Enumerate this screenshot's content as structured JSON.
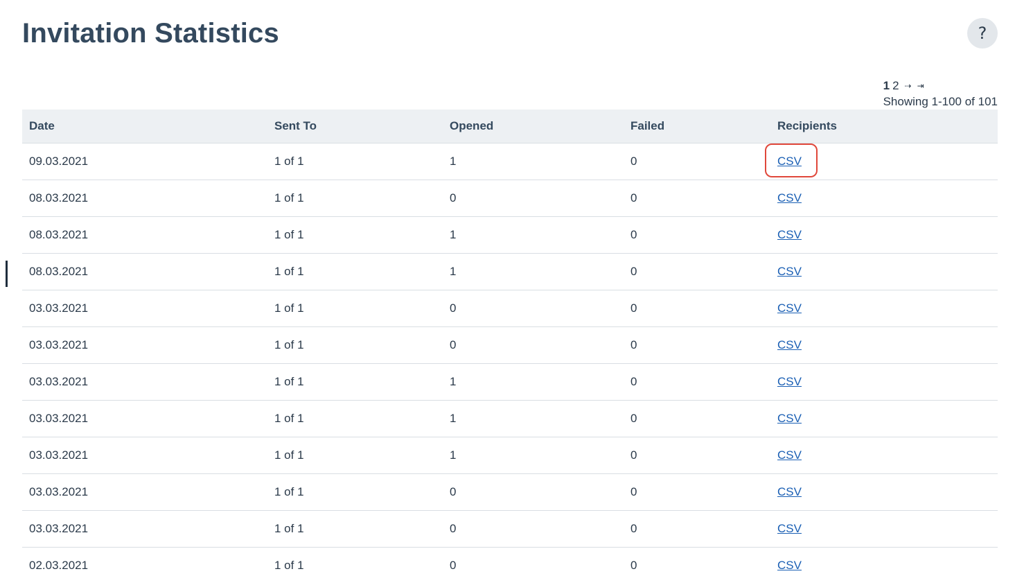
{
  "header": {
    "title": "Invitation Statistics",
    "help_label": "?"
  },
  "pagination": {
    "current_page": "1",
    "next_page": "2",
    "next_arrow": "⇢",
    "last_arrow": "⇥",
    "summary": "Showing 1-100 of 101"
  },
  "table": {
    "columns": [
      "Date",
      "Sent To",
      "Opened",
      "Failed",
      "Recipients"
    ],
    "rows": [
      {
        "date": "09.03.2021",
        "sent_to": "1 of 1",
        "opened": "1",
        "failed": "0",
        "recipients": "CSV"
      },
      {
        "date": "08.03.2021",
        "sent_to": "1 of 1",
        "opened": "0",
        "failed": "0",
        "recipients": "CSV"
      },
      {
        "date": "08.03.2021",
        "sent_to": "1 of 1",
        "opened": "1",
        "failed": "0",
        "recipients": "CSV"
      },
      {
        "date": "08.03.2021",
        "sent_to": "1 of 1",
        "opened": "1",
        "failed": "0",
        "recipients": "CSV"
      },
      {
        "date": "03.03.2021",
        "sent_to": "1 of 1",
        "opened": "0",
        "failed": "0",
        "recipients": "CSV"
      },
      {
        "date": "03.03.2021",
        "sent_to": "1 of 1",
        "opened": "0",
        "failed": "0",
        "recipients": "CSV"
      },
      {
        "date": "03.03.2021",
        "sent_to": "1 of 1",
        "opened": "1",
        "failed": "0",
        "recipients": "CSV"
      },
      {
        "date": "03.03.2021",
        "sent_to": "1 of 1",
        "opened": "1",
        "failed": "0",
        "recipients": "CSV"
      },
      {
        "date": "03.03.2021",
        "sent_to": "1 of 1",
        "opened": "1",
        "failed": "0",
        "recipients": "CSV"
      },
      {
        "date": "03.03.2021",
        "sent_to": "1 of 1",
        "opened": "0",
        "failed": "0",
        "recipients": "CSV"
      },
      {
        "date": "03.03.2021",
        "sent_to": "1 of 1",
        "opened": "0",
        "failed": "0",
        "recipients": "CSV"
      },
      {
        "date": "02.03.2021",
        "sent_to": "1 of 1",
        "opened": "0",
        "failed": "0",
        "recipients": "CSV"
      }
    ]
  },
  "colors": {
    "title": "#34495e",
    "link": "#1a5fb4",
    "header_bg": "#edf0f3",
    "highlight": "#e0473a"
  }
}
